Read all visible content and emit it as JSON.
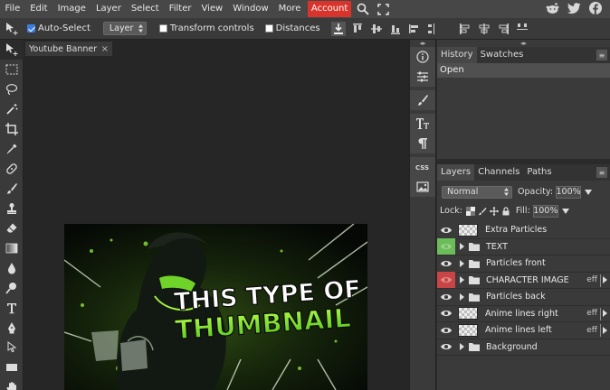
{
  "menu": {
    "items": [
      "File",
      "Edit",
      "Image",
      "Layer",
      "Select",
      "Filter",
      "View",
      "Window",
      "More"
    ],
    "account": "Account"
  },
  "options": {
    "auto_select": "Auto-Select",
    "select_value": "Layer",
    "transform_controls": "Transform controls",
    "distances": "Distances"
  },
  "document": {
    "tab_title": "Youtube Banner",
    "tab_close": "×",
    "canvas_text_line1": "THIS TYPE OF",
    "canvas_text_line2": "THUMBNAIL"
  },
  "history_panel": {
    "tabs": [
      "History",
      "Swatches"
    ],
    "items": [
      "Open"
    ]
  },
  "layers_panel": {
    "tabs": [
      "Layers",
      "Channels",
      "Paths"
    ],
    "blend_mode": "Normal",
    "opacity_label": "Opacity:",
    "opacity_value": "100%",
    "lock_label": "Lock:",
    "fill_label": "Fill:",
    "fill_value": "100%",
    "layers": [
      {
        "name": "Extra Particles",
        "type": "layer",
        "eye": "normal"
      },
      {
        "name": "TEXT",
        "type": "folder",
        "eye": "green"
      },
      {
        "name": "Particles front",
        "type": "folder",
        "eye": "normal"
      },
      {
        "name": "CHARACTER IMAGE",
        "type": "folder",
        "eye": "red",
        "eff": "eff"
      },
      {
        "name": "Particles back",
        "type": "folder",
        "eye": "normal"
      },
      {
        "name": "Anime lines right",
        "type": "layer",
        "eye": "normal",
        "eff": "eff"
      },
      {
        "name": "Anime lines left",
        "type": "layer",
        "eye": "normal",
        "eff": "eff"
      },
      {
        "name": "Background",
        "type": "folder",
        "eye": "normal"
      }
    ]
  },
  "colors": {
    "accent_red": "#d9342b",
    "checkbox_blue": "#3b7de0",
    "visibility_green": "#6bbd59",
    "visibility_red": "#c94545",
    "thumbnail_green": "#7ee02a"
  }
}
